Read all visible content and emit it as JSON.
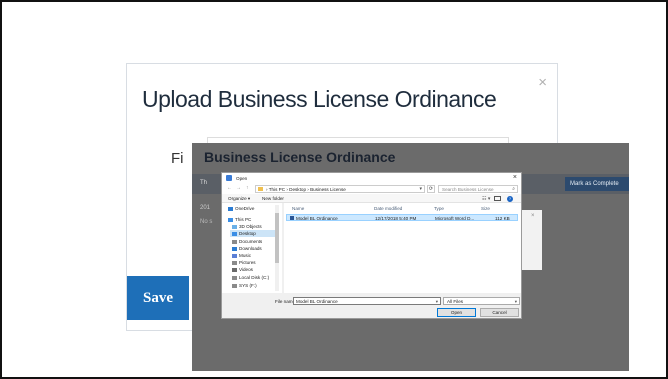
{
  "upload_modal": {
    "title": "Upload Business License Ordinance",
    "close": "×",
    "file_label_partial": "Fi",
    "save_label": "Save"
  },
  "overlay": {
    "title": "Business License Ordinance",
    "toolbar_partial": "Th",
    "mark_complete_partial": "Mark as Complete",
    "row1_partial": "201",
    "row2_partial": "No s",
    "panel_close": "×"
  },
  "open_dialog": {
    "title": "Open",
    "close": "×",
    "nav": {
      "back": "←",
      "forward": "→",
      "up": "↑"
    },
    "breadcrumb": "›  This PC  ›  Desktop  ›  Business License",
    "refresh": "⟳",
    "search_placeholder": "Search Business License",
    "organize_label": "Organize ▾",
    "new_folder_label": "New folder",
    "view_glyph": "☷ ▾",
    "help": "?",
    "nav_items": [
      {
        "label": "OneDrive",
        "icon_color": "#2b7cd3"
      },
      {
        "label": "This PC",
        "icon_color": "#3a8ee6"
      },
      {
        "label": "3D Objects",
        "icon_color": "#6ab0e8"
      },
      {
        "label": "Desktop",
        "icon_color": "#3a8ee6",
        "selected": true
      },
      {
        "label": "Documents",
        "icon_color": "#8a8a8a"
      },
      {
        "label": "Downloads",
        "icon_color": "#2b7cd3"
      },
      {
        "label": "Music",
        "icon_color": "#5a7fd6"
      },
      {
        "label": "Pictures",
        "icon_color": "#8a8a8a"
      },
      {
        "label": "Videos",
        "icon_color": "#6a6a6a"
      },
      {
        "label": "Local Disk (C:)",
        "icon_color": "#8a8a8a"
      },
      {
        "label": "SYS (F:)",
        "icon_color": "#8a8a8a"
      }
    ],
    "columns": {
      "name": "Name",
      "date": "Date modified",
      "type": "Type",
      "size": "Size"
    },
    "files": [
      {
        "name": "Model BL Ordinance",
        "date": "12/17/2018 5:40 PM",
        "type": "Microsoft Word D...",
        "size": "112 KB"
      }
    ],
    "file_name_label": "File name:",
    "file_name_value": "Model BL Ordinance",
    "file_type_value": "All Files",
    "dropdown": "▾",
    "open_label": "Open",
    "cancel_label": "Cancel"
  }
}
